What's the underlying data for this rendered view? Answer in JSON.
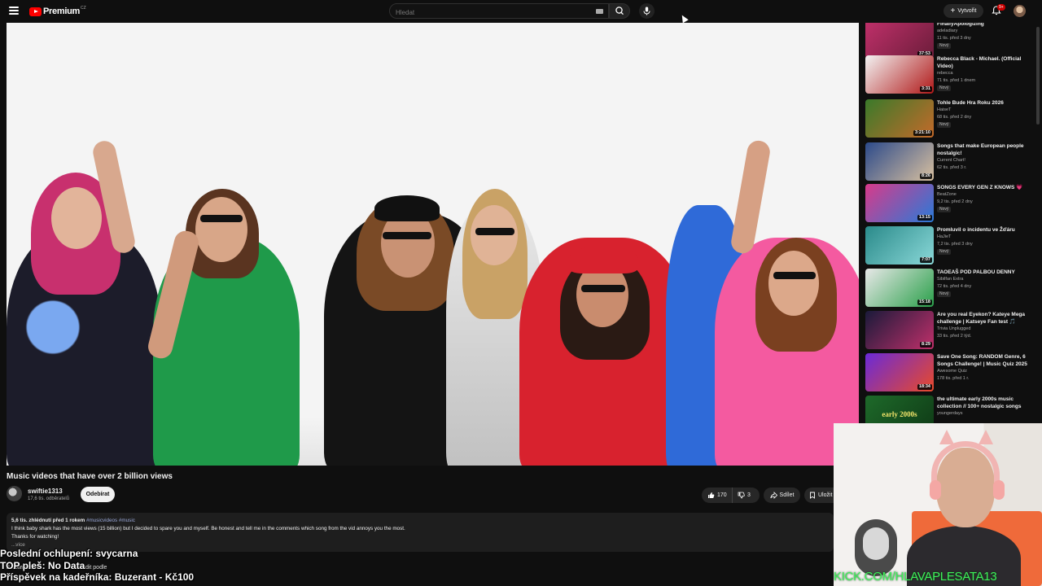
{
  "app": {
    "logo_text": "Premium",
    "logo_region": "CZ",
    "search_placeholder": "Hledat",
    "create_label": "Vytvořit",
    "notification_count": "9+",
    "icons": {
      "menu": "menu-icon",
      "search": "search-icon",
      "mic": "mic-icon",
      "bell": "bell-icon",
      "keyboard": "keyboard-icon"
    }
  },
  "video": {
    "title": "Music videos that have over 2 billion views",
    "channel_name": "swiftie1313",
    "subscribers": "17,6 tis. odběratelů",
    "subscribe_label": "Odebírat",
    "likes": "170",
    "dislikes": "3",
    "share_label": "Sdílet",
    "save_label": "Uložit"
  },
  "description": {
    "stats": "5,6 tis. zhlédnutí  před 1 rokem",
    "tags": "#musicvideos #music",
    "line1": "I think baby shark has the most views (15 billion) but I decided to spare you and myself. Be honest and tell me in the comments which song from the vid annoys you the most.",
    "line2": "Thanks for watching!",
    "more": "...více"
  },
  "comments": {
    "count_label": "2 komentáře",
    "sort_label": "Řadit podle"
  },
  "overlay": {
    "line1": "Poslední ochlupení: svycarna",
    "line2": "TOP pleš: No Data",
    "line3": "Příspěvek na kadeřníka: Buzerant - Kč100",
    "kick": "KICK.COM/HLAVAPLESATA13"
  },
  "recommendations": [
    {
      "title": "FinallyApologizing",
      "channel": "adeladiary",
      "meta": "11 tis.  před 3 dny",
      "badge": "Nový",
      "duration": "37:53",
      "thumb": [
        "#c0306a",
        "#6b1d3a"
      ]
    },
    {
      "title": "Rebecca Black - Michael. (Official Video)",
      "channel": "rebecca",
      "meta": "71 tis.  před 1 dnem",
      "badge": "Nový",
      "duration": "3:31",
      "thumb": [
        "#f3f3f3",
        "#b01818"
      ]
    },
    {
      "title": "Tohle Bude Hra Roku 2026",
      "channel": "HaiseT",
      "meta": "68 tis.  před 2 dny",
      "badge": "Nový",
      "duration": "3:21:10",
      "thumb": [
        "#3a7a2a",
        "#c46a2a"
      ]
    },
    {
      "title": "Songs that make European people nostalgic!",
      "channel": "Current Chart!",
      "meta": "62 tis.  před 3 r.",
      "badge": "",
      "duration": "8:26",
      "thumb": [
        "#2c4a8a",
        "#d8c0a0"
      ]
    },
    {
      "title": "SONGS EVERY GEN Z KNOWS 💗",
      "channel": "BeatZone",
      "meta": "9,2 tis.  před 2 dny",
      "badge": "Nový",
      "duration": "13:15",
      "thumb": [
        "#d83a8a",
        "#2a7ad8"
      ]
    },
    {
      "title": "Promluvil o incidentu ve Žďáru",
      "channel": "HaJieT",
      "meta": "7,2 tis.  před 3 dny",
      "badge": "Nový",
      "duration": "7:07",
      "thumb": [
        "#2a8a8a",
        "#8ad8d8"
      ]
    },
    {
      "title": "TAOEAŠ POD PALBOU DENNY",
      "channel": "Sibilfan Extra",
      "meta": "72 tis.  před 4 dny",
      "badge": "Nový",
      "duration": "15:18",
      "thumb": [
        "#e8e8e8",
        "#2aa04a"
      ]
    },
    {
      "title": "Are you real Eyekon? Kateye Mega challenge | Katseye Fan test 🎵",
      "channel": "Trivia Unplugged",
      "meta": "33 tis.  před 2 týd.",
      "badge": "",
      "duration": "8:29",
      "thumb": [
        "#1a1a3a",
        "#c0306a"
      ]
    },
    {
      "title": "Save One Song: RANDOM Genre, 6 Songs Challenge! | Music Quiz 2025",
      "channel": "Awesome Quiz",
      "meta": "178 tis.  před 1 r.",
      "badge": "",
      "duration": "18:34",
      "thumb": [
        "#6a2ad8",
        "#e84a2a"
      ]
    },
    {
      "title": "the ultimate early 2000s music collection // 100+ nostalgic songs",
      "channel": "youngerdays",
      "meta": "",
      "badge": "",
      "duration": "",
      "thumb": [
        "#1e6a2a",
        "#0f3a16"
      ],
      "thumb_text": "early 2000s"
    }
  ],
  "colors": {
    "background": "#0f0f0f",
    "brand_red": "#ff0000",
    "overlay_green": "#3ef05a"
  }
}
